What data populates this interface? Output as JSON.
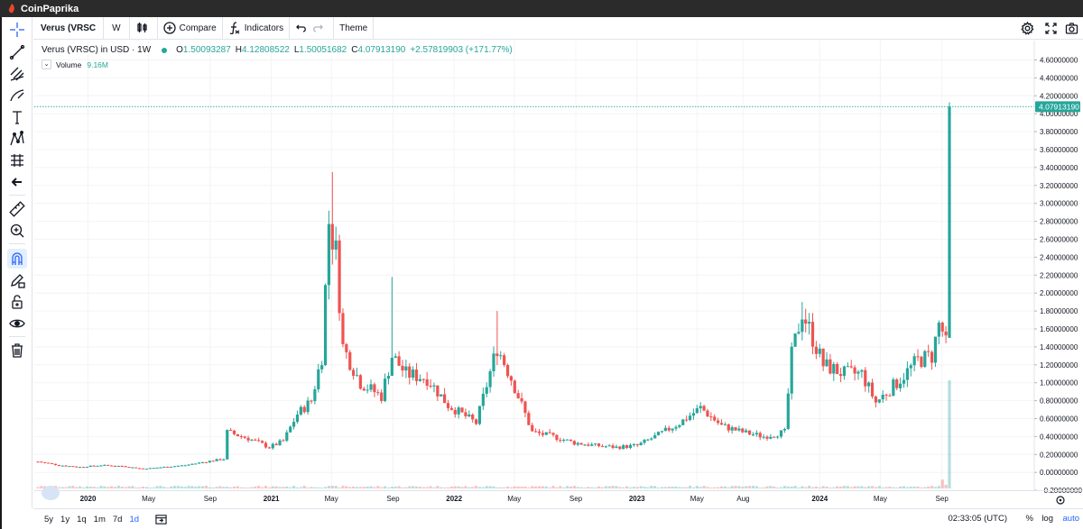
{
  "app": {
    "title": "CoinPaprika"
  },
  "toolbar": {
    "symbol": "Verus (VRSC",
    "interval": "W",
    "compare": "Compare",
    "indicators": "Indicators",
    "theme": "Theme"
  },
  "legend": {
    "title": "Verus (VRSC) in USD · 1W",
    "open_label": "O",
    "open": "1.50093287",
    "high_label": "H",
    "high": "4.12808522",
    "low_label": "L",
    "low": "1.50051682",
    "close_label": "C",
    "close": "4.07913190",
    "change": "+2.57819903 (+171.77%)"
  },
  "volume_legend": {
    "label": "Volume",
    "value": "9.16M"
  },
  "bottom": {
    "ranges": [
      "5y",
      "1y",
      "1q",
      "1m",
      "7d",
      "1d"
    ],
    "active_range": "1d",
    "time": "02:33:05 (UTC)",
    "percent": "%",
    "log": "log",
    "auto": "auto"
  },
  "colors": {
    "up": "#26a69a",
    "down": "#ef5350",
    "accent": "#2962ff"
  },
  "chart_data": {
    "type": "candlestick",
    "title": "Verus (VRSC) in USD · 1W",
    "ylim": [
      -0.3,
      4.7
    ],
    "y_ticks": [
      "4.60000000",
      "4.40000000",
      "4.20000000",
      "4.00000000",
      "3.80000000",
      "3.60000000",
      "3.40000000",
      "3.20000000",
      "3.00000000",
      "2.80000000",
      "2.60000000",
      "2.40000000",
      "2.20000000",
      "2.00000000",
      "1.80000000",
      "1.60000000",
      "1.40000000",
      "1.20000000",
      "1.00000000",
      "0.80000000",
      "0.60000000",
      "0.40000000",
      "0.20000000",
      "0.00000000",
      "−0.20000000"
    ],
    "x_tick_labels": [
      "2020",
      "May",
      "Sep",
      "2021",
      "May",
      "Sep",
      "2022",
      "May",
      "Sep",
      "2023",
      "May",
      "Aug",
      "2024",
      "May",
      "Sep"
    ],
    "last_price_label": "4.07913190",
    "last_price": 4.0791319,
    "x_start": "2019-09-23",
    "x_end": "2024-09-16",
    "anchors": [
      {
        "date": "2019-09-23",
        "price": 0.12
      },
      {
        "date": "2019-11-04",
        "price": 0.08
      },
      {
        "date": "2019-12-16",
        "price": 0.06
      },
      {
        "date": "2020-01-27",
        "price": 0.08
      },
      {
        "date": "2020-03-09",
        "price": 0.07
      },
      {
        "date": "2020-04-20",
        "price": 0.04
      },
      {
        "date": "2020-06-01",
        "price": 0.06
      },
      {
        "date": "2020-07-13",
        "price": 0.08
      },
      {
        "date": "2020-08-24",
        "price": 0.12
      },
      {
        "date": "2020-09-28",
        "price": 0.15
      },
      {
        "date": "2020-10-05",
        "price": 0.45
      },
      {
        "date": "2020-11-16",
        "price": 0.38
      },
      {
        "date": "2020-12-28",
        "price": 0.28
      },
      {
        "date": "2021-01-25",
        "price": 0.35
      },
      {
        "date": "2021-02-22",
        "price": 0.65
      },
      {
        "date": "2021-03-22",
        "price": 0.8
      },
      {
        "date": "2021-04-12",
        "price": 1.3
      },
      {
        "date": "2021-04-26",
        "price": 2.8
      },
      {
        "date": "2021-05-10",
        "price": 2.45
      },
      {
        "date": "2021-05-24",
        "price": 1.4
      },
      {
        "date": "2021-06-28",
        "price": 1.0
      },
      {
        "date": "2021-08-09",
        "price": 0.85
      },
      {
        "date": "2021-08-30",
        "price": 1.3
      },
      {
        "date": "2021-09-27",
        "price": 1.1
      },
      {
        "date": "2021-11-08",
        "price": 1.05
      },
      {
        "date": "2021-12-20",
        "price": 0.75
      },
      {
        "date": "2022-02-14",
        "price": 0.55
      },
      {
        "date": "2022-03-28",
        "price": 1.4
      },
      {
        "date": "2022-04-25",
        "price": 1.05
      },
      {
        "date": "2022-06-06",
        "price": 0.45
      },
      {
        "date": "2022-07-18",
        "price": 0.4
      },
      {
        "date": "2022-08-29",
        "price": 0.33
      },
      {
        "date": "2022-10-10",
        "price": 0.3
      },
      {
        "date": "2022-11-21",
        "price": 0.28
      },
      {
        "date": "2023-01-02",
        "price": 0.3
      },
      {
        "date": "2023-02-13",
        "price": 0.42
      },
      {
        "date": "2023-03-27",
        "price": 0.55
      },
      {
        "date": "2023-05-08",
        "price": 0.72
      },
      {
        "date": "2023-06-19",
        "price": 0.52
      },
      {
        "date": "2023-07-31",
        "price": 0.45
      },
      {
        "date": "2023-09-11",
        "price": 0.4
      },
      {
        "date": "2023-10-23",
        "price": 0.45
      },
      {
        "date": "2023-11-06",
        "price": 1.3
      },
      {
        "date": "2023-11-27",
        "price": 1.8
      },
      {
        "date": "2024-01-08",
        "price": 1.2
      },
      {
        "date": "2024-02-19",
        "price": 1.1
      },
      {
        "date": "2024-03-25",
        "price": 1.1
      },
      {
        "date": "2024-04-22",
        "price": 0.78
      },
      {
        "date": "2024-06-03",
        "price": 1.0
      },
      {
        "date": "2024-07-15",
        "price": 1.25
      },
      {
        "date": "2024-08-12",
        "price": 1.3
      },
      {
        "date": "2024-08-26",
        "price": 1.65
      },
      {
        "date": "2024-09-09",
        "price": 1.5
      },
      {
        "date": "2024-09-16",
        "price": 4.08
      }
    ],
    "spike_highs": [
      {
        "date": "2021-05-03",
        "high": 3.35
      },
      {
        "date": "2021-08-30",
        "high": 2.18
      },
      {
        "date": "2022-03-28",
        "high": 1.8
      },
      {
        "date": "2023-11-27",
        "high": 1.9
      },
      {
        "date": "2024-09-16",
        "high": 4.12808522
      }
    ],
    "volume_unit_max": 9.16
  }
}
